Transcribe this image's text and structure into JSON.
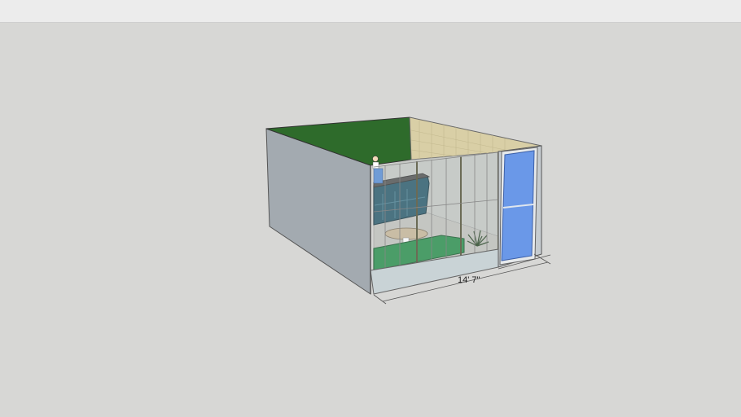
{
  "app": {
    "top_bar": ""
  },
  "model": {
    "dimension_label": "14' 7\"",
    "colors": {
      "background": "#d7d7d5",
      "roof_green": "#2e6b2b",
      "ceiling_mesh": "#d9cfa6",
      "wall_side": "#a3aab0",
      "wall_front_base": "#c9d3d6",
      "door_glass": "#6a98e8",
      "counter_teal": "#2f5d6e",
      "sofa_green": "#2f9150",
      "floor": "#bdbdb8"
    },
    "icons": [
      "person-figure-icon",
      "plant-icon"
    ]
  }
}
